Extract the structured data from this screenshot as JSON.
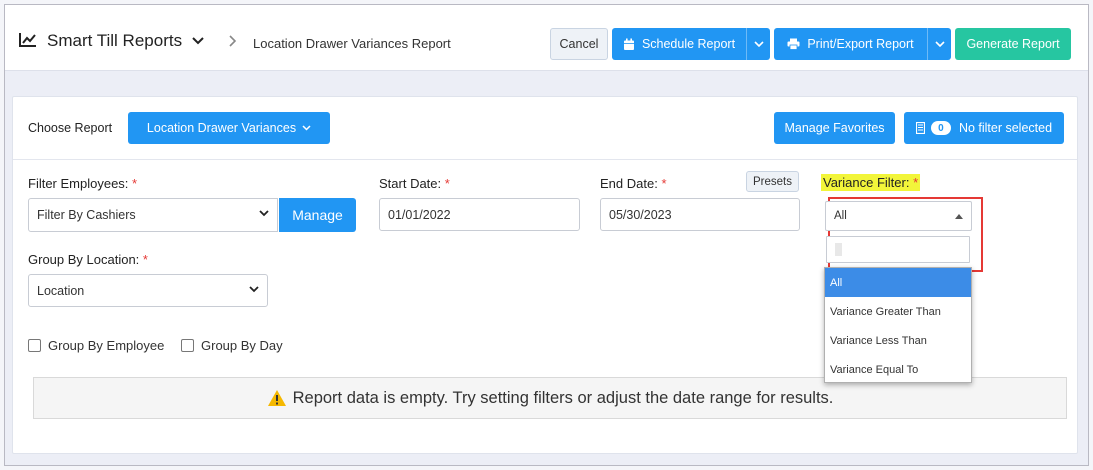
{
  "header": {
    "app_title": "Smart Till Reports",
    "breadcrumb": "Location Drawer Variances Report",
    "cancel_label": "Cancel",
    "schedule_label": "Schedule Report",
    "print_label": "Print/Export Report",
    "generate_label": "Generate Report"
  },
  "report": {
    "choose_label": "Choose Report",
    "selected_report": "Location Drawer Variances",
    "manage_favorites_label": "Manage Favorites",
    "filter_count": "0",
    "filter_status": "No filter selected"
  },
  "filters": {
    "employees_label": "Filter Employees:",
    "employees_value": "Filter By Cashiers",
    "manage_label": "Manage",
    "start_date_label": "Start Date:",
    "start_date_value": "01/01/2022",
    "end_date_label": "End Date:",
    "end_date_value": "05/30/2023",
    "presets_label": "Presets",
    "variance_label": "Variance Filter:",
    "variance_value": "All",
    "variance_options": [
      "All",
      "Variance Greater Than",
      "Variance Less Than",
      "Variance Equal To"
    ],
    "group_location_label": "Group By Location:",
    "group_location_value": "Location",
    "group_employee_label": "Group By Employee",
    "group_day_label": "Group By Day",
    "required_mark": "*"
  },
  "message": {
    "empty_text": "Report data is empty. Try setting filters or adjust the date range for results."
  },
  "colors": {
    "primary": "#2196f3",
    "success": "#26c6a1",
    "highlight": "#f2f53a",
    "danger": "#e53935"
  }
}
